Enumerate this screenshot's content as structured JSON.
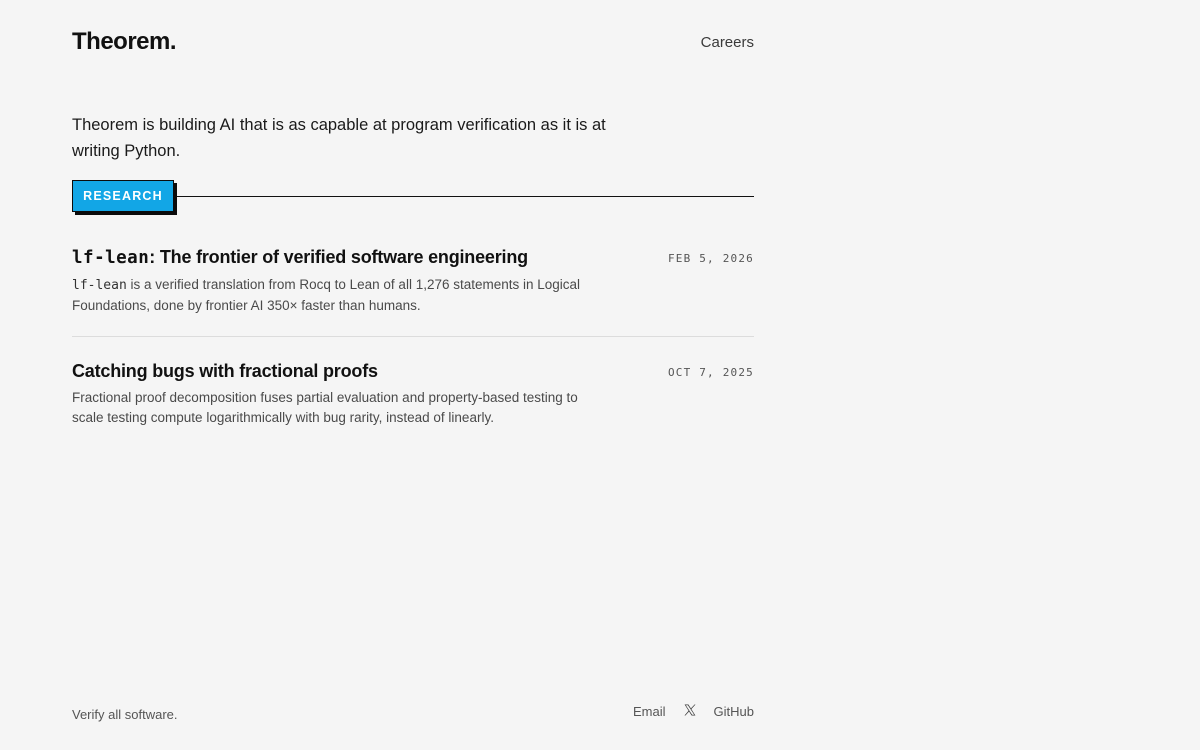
{
  "header": {
    "logo": "Theorem.",
    "nav_careers": "Careers"
  },
  "intro": {
    "text": "Theorem is building AI that is as capable at program verification as it is at writing Python."
  },
  "section": {
    "label": "RESEARCH"
  },
  "posts": [
    {
      "title_code": "lf-lean",
      "title_rest": ": The frontier of verified software engineering",
      "date": "FEB 5, 2026",
      "desc_code": "lf-lean",
      "desc_rest": " is a verified translation from Rocq to Lean of all 1,276 statements in Logical Foundations, done by frontier AI 350× faster than humans."
    },
    {
      "title": "Catching bugs with fractional proofs",
      "date": "OCT 7, 2025",
      "desc": "Fractional proof decomposition fuses partial evaluation and property-based testing to scale testing compute logarithmically with bug rarity, instead of linearly."
    }
  ],
  "footer": {
    "tagline": "Verify all software.",
    "links": {
      "email": "Email",
      "x_icon": "x-icon",
      "github": "GitHub"
    }
  },
  "colors": {
    "background": "#f5f5f5",
    "accent": "#12a6e6",
    "text": "#141414"
  }
}
